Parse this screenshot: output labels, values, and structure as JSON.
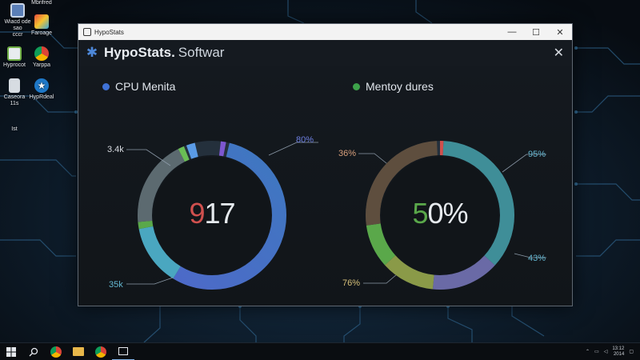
{
  "desktop": {
    "icons": [
      {
        "label": "Wiacd ode\nsao\ncccr",
        "icon": "monitor-icon"
      },
      {
        "label": "Mbrifred",
        "icon": "document-icon"
      },
      {
        "label": "Faroage",
        "icon": "colorful-app-icon"
      },
      {
        "label": "Hyprocot",
        "icon": "leaf-app-icon"
      },
      {
        "label": "Yarppa",
        "icon": "chrome-icon"
      },
      {
        "label": "Caseora\n11s",
        "icon": "recycle-bin-icon"
      },
      {
        "label": "HypRdeal",
        "icon": "star-app-icon"
      },
      {
        "label": "Ist",
        "icon": "shortcut-icon"
      }
    ]
  },
  "window": {
    "title": "HypoStats",
    "brand": "HypoStats.",
    "brand_sub": "Softwar",
    "controls": {
      "minimize": "—",
      "maximize": "☐",
      "close": "✕"
    },
    "header_close": "✕"
  },
  "panels": [
    {
      "title": "CPU Menita",
      "dot_color": "#3f72d6",
      "center_value_red": "9",
      "center_value_rest": "17",
      "callouts": [
        "3.4k",
        "80%",
        "35k"
      ]
    },
    {
      "title": "Mentoy dures",
      "dot_color": "#3da24a",
      "center_value_green": "5",
      "center_value_rest": "0%",
      "callouts": [
        "36%",
        "95%",
        "43%",
        "76%"
      ]
    }
  ],
  "taskbar": {
    "icons": [
      "windows-start-icon",
      "search-icon",
      "chrome-icon",
      "file-explorer-icon",
      "chrome-icon-2",
      "app-icon"
    ],
    "clock_time": "13:12",
    "clock_date": "2014"
  },
  "colors": {
    "accent_blue": "#4a6fd0",
    "teal": "#4aa0b6",
    "green": "#5aa84a",
    "red": "#d0504e",
    "window_bg": "#151a20"
  }
}
